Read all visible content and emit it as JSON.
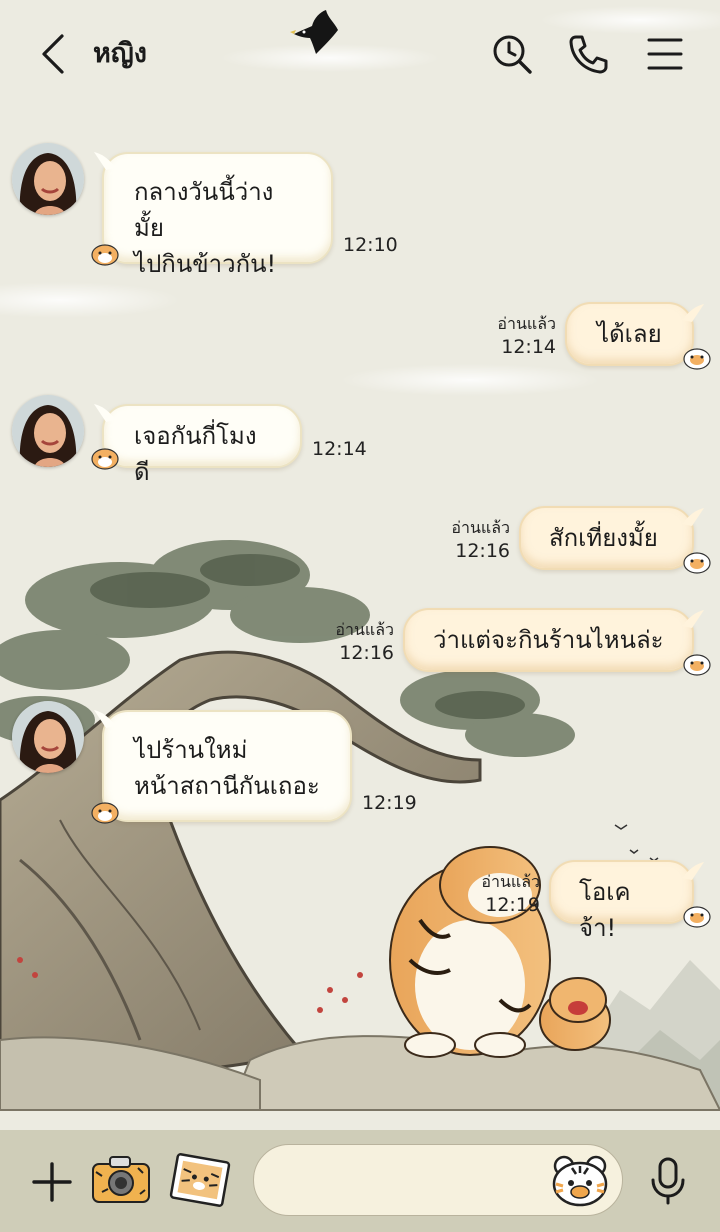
{
  "header": {
    "back_label": "back",
    "title": "หญิง"
  },
  "colors": {
    "bubble_in": "#fffef7",
    "bubble_out": "#fff3dc",
    "bottom_bar": "#cfcdb8"
  },
  "icons": [
    "chevron-left-icon",
    "clock-search-icon",
    "phone-icon",
    "menu-icon",
    "crow-icon",
    "plus-icon",
    "camera-icon",
    "photo-icon",
    "tiger-sticker-icon",
    "microphone-icon"
  ],
  "messages": [
    {
      "side": "in",
      "text": "กลางวันนี้ว่างมั้ย\nไปกินข้าวกัน!",
      "time": "12:10"
    },
    {
      "side": "out",
      "text": "ได้เลย",
      "read": "อ่านแล้ว",
      "time": "12:14"
    },
    {
      "side": "in",
      "text": "เจอกันกี่โมงดี",
      "time": "12:14"
    },
    {
      "side": "out",
      "text": "สักเที่ยงมั้ย",
      "read": "อ่านแล้ว",
      "time": "12:16"
    },
    {
      "side": "out",
      "text": "ว่าแต่จะกินร้านไหนล่ะ",
      "read": "อ่านแล้ว",
      "time": "12:16"
    },
    {
      "side": "in",
      "text": "ไปร้านใหม่\nหน้าสถานีกันเถอะ",
      "time": "12:19"
    },
    {
      "side": "out",
      "text": "โอเคจ้า!",
      "read": "อ่านแล้ว",
      "time": "12:19"
    }
  ],
  "input": {
    "value": "",
    "placeholder": ""
  }
}
